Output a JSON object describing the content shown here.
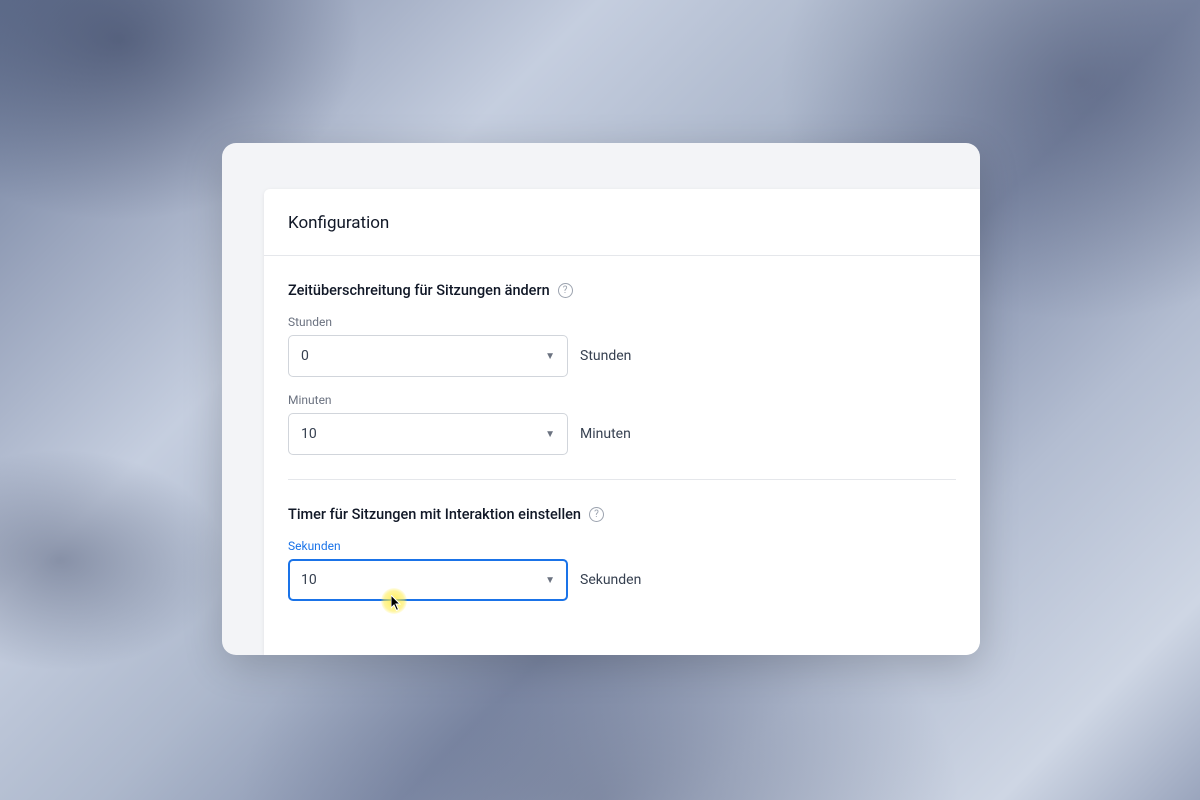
{
  "card": {
    "title": "Konfiguration"
  },
  "section1": {
    "title": "Zeitüberschreitung für Sitzungen ändern",
    "hours": {
      "label": "Stunden",
      "value": "0",
      "suffix": "Stunden"
    },
    "minutes": {
      "label": "Minuten",
      "value": "10",
      "suffix": "Minuten"
    }
  },
  "section2": {
    "title": "Timer für Sitzungen mit Interaktion einstellen",
    "seconds": {
      "label": "Sekunden",
      "value": "10",
      "suffix": "Sekunden"
    }
  }
}
